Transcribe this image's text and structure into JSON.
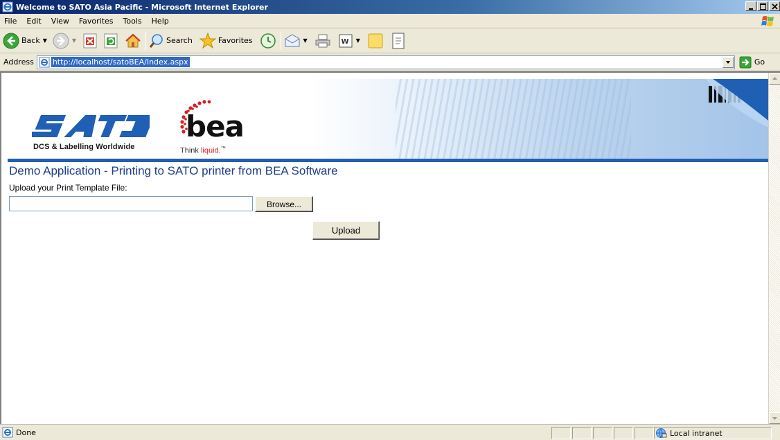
{
  "window": {
    "title": "Welcome to SATO Asia Pacific - Microsoft Internet Explorer"
  },
  "menu": [
    "File",
    "Edit",
    "View",
    "Favorites",
    "Tools",
    "Help"
  ],
  "toolbar": {
    "back_label": "Back",
    "search_label": "Search",
    "favorites_label": "Favorites"
  },
  "address": {
    "label": "Address",
    "url": "http://localhost/satoBEA/Index.aspx",
    "go_label": "Go"
  },
  "banner": {
    "sato_tagline": "DCS & Labelling Worldwide",
    "bea_word": "bea",
    "bea_tagline_think": "Think ",
    "bea_tagline_liquid": "liquid.",
    "bea_tagline_tm": "™"
  },
  "page": {
    "heading": "Demo Application - Printing to SATO printer from BEA Software",
    "upload_label": "Upload your Print Template File:",
    "file_value": "",
    "browse_label": "Browse...",
    "upload_label_btn": "Upload"
  },
  "status": {
    "text": "Done",
    "zone": "Local intranet"
  },
  "colors": {
    "heading": "#1a3f8c",
    "rule": "#1f5fb4",
    "sato_blue": "#1f5fb4",
    "bea_red": "#d62020"
  }
}
